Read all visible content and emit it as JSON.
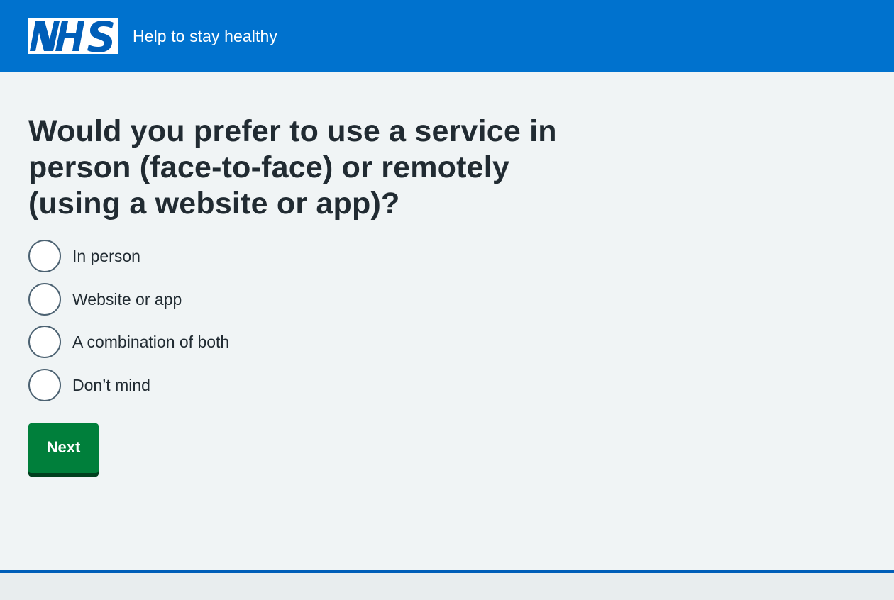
{
  "header": {
    "logo_text": "NHS",
    "service_name": "Help to stay healthy"
  },
  "question": {
    "title": "Would you prefer to use a service in person (face-to-face) or remotely (using a website or app)?"
  },
  "options": [
    {
      "label": "In person",
      "selected": false
    },
    {
      "label": "Website or app",
      "selected": false
    },
    {
      "label": "A combination of both",
      "selected": false
    },
    {
      "label": "Don’t mind",
      "selected": false
    }
  ],
  "actions": {
    "next_label": "Next"
  },
  "colors": {
    "header_blue": "#0072ce",
    "button_green": "#007f3b",
    "text": "#212b32",
    "background": "#f0f4f5"
  }
}
